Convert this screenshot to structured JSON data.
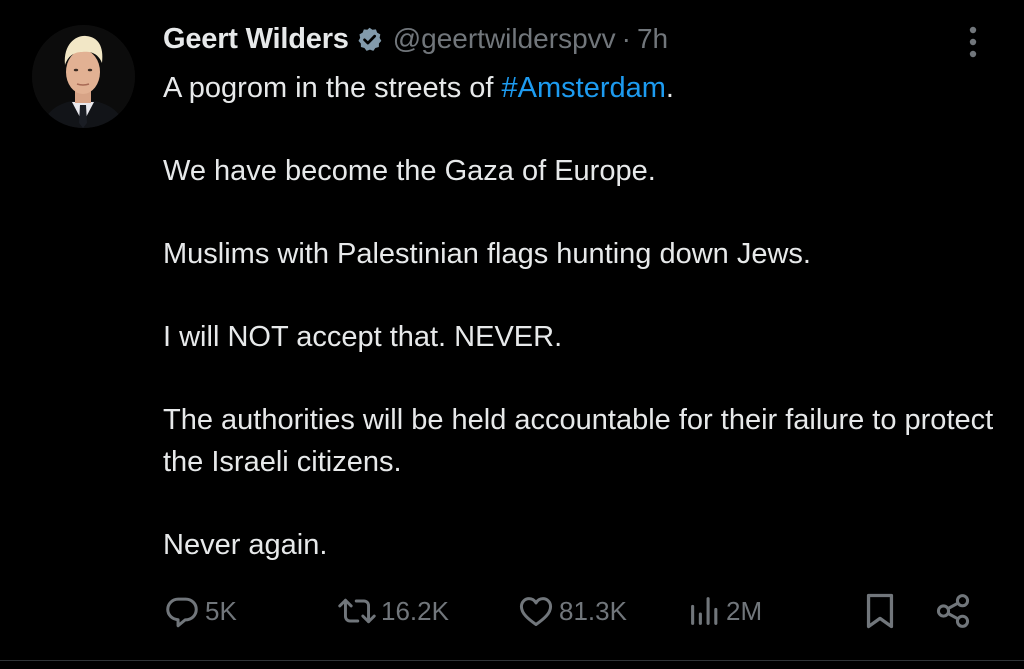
{
  "user": {
    "display_name": "Geert Wilders",
    "handle": "@geertwilderspvv",
    "separator": "·",
    "time": "7h",
    "verified": true
  },
  "tweet": {
    "line1_prefix": "A pogrom in the streets of ",
    "hashtag": "#Amsterdam",
    "line1_suffix": ".",
    "paragraphs": [
      "We have become the Gaza of Europe.",
      "Muslims with Palestinian flags hunting down Jews.",
      "I will NOT accept that. NEVER.",
      "The authorities will be held accountable for their failure to protect the Israeli citizens.",
      "Never again."
    ]
  },
  "actions": {
    "reply_count": "5K",
    "retweet_count": "16.2K",
    "like_count": "81.3K",
    "views_count": "2M"
  },
  "colors": {
    "background": "#000000",
    "text": "#e7e9ea",
    "secondary": "#71767b",
    "link": "#1d9bf0",
    "verified_badge": "#829aab"
  },
  "icons": [
    "verified-badge-icon",
    "more-icon",
    "reply-icon",
    "retweet-icon",
    "like-icon",
    "views-icon",
    "bookmark-icon",
    "share-icon"
  ]
}
